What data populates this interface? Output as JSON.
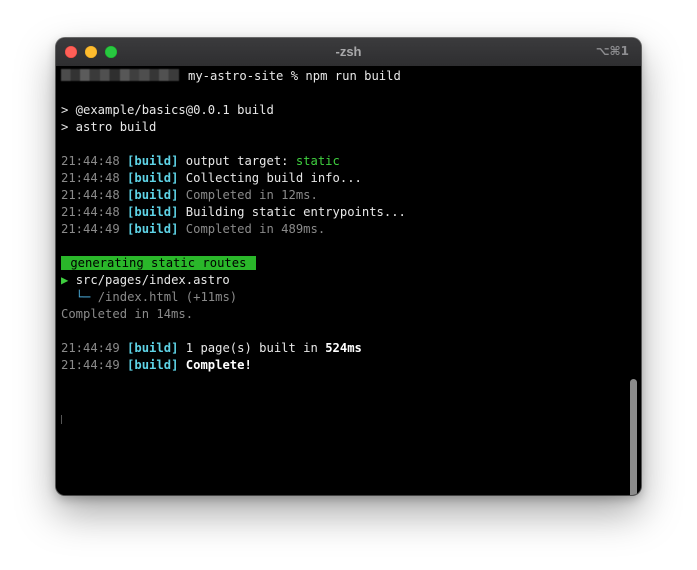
{
  "window": {
    "title": "-zsh",
    "shortcut": "⌥⌘1"
  },
  "prompt": {
    "directory": "my-astro-site",
    "symbol": "%",
    "command": "npm run build"
  },
  "npm": {
    "line1": "> @example/basics@0.0.1 build",
    "line2": "> astro build"
  },
  "build_log": [
    {
      "time": "21:44:48",
      "tag": "[build]",
      "text": "output target: ",
      "extra": "static"
    },
    {
      "time": "21:44:48",
      "tag": "[build]",
      "text": "Collecting build info..."
    },
    {
      "time": "21:44:48",
      "tag": "[build]",
      "text": "Completed in 12ms."
    },
    {
      "time": "21:44:48",
      "tag": "[build]",
      "text": "Building static entrypoints..."
    },
    {
      "time": "21:44:49",
      "tag": "[build]",
      "text": "Completed in 489ms."
    }
  ],
  "routes": {
    "header": " generating static routes ",
    "arrow": "▶",
    "page": "src/pages/index.astro",
    "tree": "└─",
    "output": "/index.html",
    "output_time": "(+11ms)",
    "completed": "Completed in 14ms."
  },
  "summary": [
    {
      "time": "21:44:49",
      "tag": "[build]",
      "text": "1 page(s) built in ",
      "strong": "524ms"
    },
    {
      "time": "21:44:49",
      "tag": "[build]",
      "text": "",
      "strong": "Complete!"
    }
  ],
  "colors": {
    "background": "#000000",
    "timestamp": "#8a8a8a",
    "tag": "#5ed3e6",
    "green": "#3fcf3f",
    "badge": "#2ab72a",
    "close": "#fe5f57",
    "minimize": "#febc2e",
    "maximize": "#28c840"
  }
}
